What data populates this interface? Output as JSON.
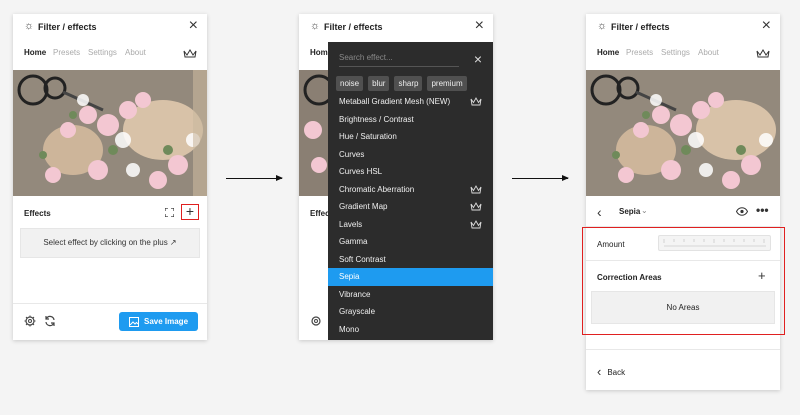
{
  "panel_title": "Filter / effects",
  "tabs": [
    "Home",
    "Presets",
    "Settings",
    "About"
  ],
  "effects_label": "Effects",
  "plus_symbol": "+",
  "hint_text": "Select effect by clicking on the plus ↗",
  "save_button_label": "Save Image",
  "dropdown": {
    "search_placeholder": "Search effect...",
    "chips": [
      "noise",
      "blur",
      "sharp",
      "premium"
    ],
    "items": [
      {
        "label": "Metaball Gradient Mesh (NEW)",
        "premium": true
      },
      {
        "label": "Brightness / Contrast",
        "premium": false
      },
      {
        "label": "Hue / Saturation",
        "premium": false
      },
      {
        "label": "Curves",
        "premium": false
      },
      {
        "label": "Curves HSL",
        "premium": false
      },
      {
        "label": "Chromatic Aberration",
        "premium": true
      },
      {
        "label": "Gradient Map",
        "premium": true
      },
      {
        "label": "Lavels",
        "premium": true
      },
      {
        "label": "Gamma",
        "premium": false
      },
      {
        "label": "Soft Contrast",
        "premium": false
      },
      {
        "label": "Sepia",
        "premium": false,
        "selected": true
      },
      {
        "label": "Vibrance",
        "premium": false
      },
      {
        "label": "Grayscale",
        "premium": false
      },
      {
        "label": "Mono",
        "premium": false
      }
    ]
  },
  "effect_detail": {
    "effect_name": "Sepia",
    "amount_label": "Amount",
    "correction_areas_label": "Correction Areas",
    "no_areas_text": "No Areas",
    "back_label": "Back"
  },
  "colors": {
    "accent": "#1e9bf0",
    "highlight_frame": "#e02020",
    "dropdown_bg": "#2c2c2c"
  },
  "icons": [
    "sun-icon",
    "close-icon",
    "crown-icon",
    "fullscreen-icon",
    "gear-icon",
    "refresh-icon",
    "chevron-left-icon",
    "chevron-down-icon",
    "eye-icon",
    "more-icon",
    "plus-icon"
  ]
}
